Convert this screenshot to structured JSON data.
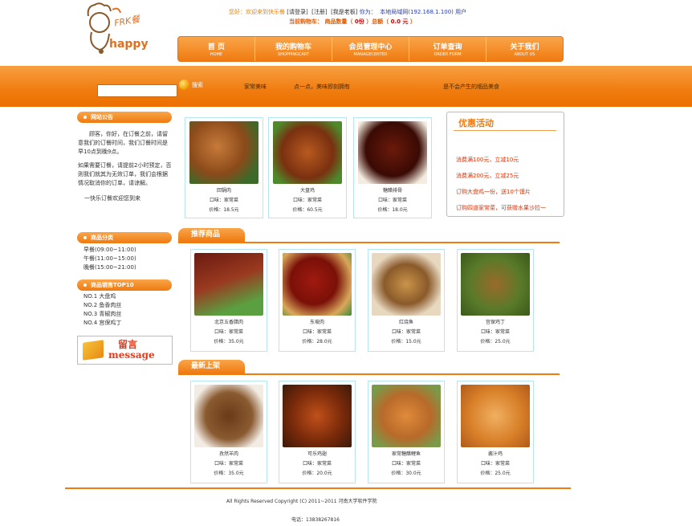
{
  "header": {
    "logo_text": "happy",
    "logo_sign": "FRK餐",
    "top_greeting": "您好：欢迎来到快乐餐",
    "login_link": "[请登录]",
    "register_link": "[注册]",
    "admin_link": "[我是老板]",
    "you_are": "你为：",
    "ip_label": "本地局域网(192.168.1.100) 用户",
    "cart_label": "当前购物车：",
    "cart_count_label": "商品数量（",
    "cart_count": "0份",
    "cart_total_label": "）总额（",
    "cart_total": "0.0 元",
    "cart_end": "）"
  },
  "nav": [
    {
      "cn": "首 页",
      "en": "HOME"
    },
    {
      "cn": "我的购物车",
      "en": "SHOPPINGCART"
    },
    {
      "cn": "会员管理中心",
      "en": "MANAGECENTER"
    },
    {
      "cn": "订单查询",
      "en": "ORDER FORM"
    },
    {
      "cn": "关于我们",
      "en": "ABOUT US"
    }
  ],
  "band": {
    "search_button": "搜索",
    "slogan1": "家常美味",
    "slogan2": "点一点，美味即刻拥有",
    "slogan3": "是不会产生的细品美食"
  },
  "sidebar": {
    "notice_title": "网站公告",
    "notice_p1": "顾客，你好，在订餐之前，请留意我们的订餐时间，我们订餐时间是早10点到晚9点。",
    "notice_p2": "如果需要订餐，请提前2小时预定，否则我们就其为无效订单，我们会根据情况取消你的订单，请谅解。",
    "notice_p3": "一快乐订餐欢迎您到来",
    "category_title": "商品分类",
    "categories": [
      "早餐(09:00~11:00)",
      "午餐(11:00~15:00)",
      "晚餐(15:00~21:00)"
    ],
    "top_title": "商品销售TOP10",
    "top_items": [
      "NO.1 大盘鸡",
      "NO.2 鱼香肉丝",
      "NO.3 青椒肉丝",
      "NO.4 宫保鸡丁"
    ],
    "message_cn": "留言",
    "message_en": "message"
  },
  "featured": [
    {
      "name": "回锅肉",
      "taste": "口味：家常菜",
      "price": "价格：18.5元"
    },
    {
      "name": "大盘鸡",
      "taste": "口味：家常菜",
      "price": "价格：60.5元"
    },
    {
      "name": "糖醋排骨",
      "taste": "口味：家常菜",
      "price": "价格：18.0元"
    }
  ],
  "promo": {
    "title": "优惠活动",
    "items": [
      "消费满100元，立减10元",
      "消费满200元，立减25元",
      "订购大盘鸡一份，送10个馍片",
      "订购四道家常菜，可获赠水果沙拉一"
    ]
  },
  "recommended": {
    "title": "推荐商品",
    "items": [
      {
        "name": "北京五香腊肉",
        "taste": "口味：家常菜",
        "price": "价格：35.0元"
      },
      {
        "name": "东坡肉",
        "taste": "口味：家常菜",
        "price": "价格：28.0元"
      },
      {
        "name": "红烧鱼",
        "taste": "口味：家常菜",
        "price": "价格：15.0元"
      },
      {
        "name": "宫保鸡丁",
        "taste": "口味：家常菜",
        "price": "价格：25.0元"
      }
    ]
  },
  "latest": {
    "title": "最新上架",
    "items": [
      {
        "name": "孜然羊肉",
        "taste": "口味：家常菜",
        "price": "价格：35.0元"
      },
      {
        "name": "可乐鸡翅",
        "taste": "口味：家常菜",
        "price": "价格：20.0元"
      },
      {
        "name": "家常糖醋鲤鱼",
        "taste": "口味：家常菜",
        "price": "价格：30.0元"
      },
      {
        "name": "酱汁鸡",
        "taste": "口味：家常菜",
        "price": "价格：25.0元"
      }
    ]
  },
  "footer": {
    "copyright": "All Rights Reserved Copyright (C) 2011~2011 河南大学软件学院",
    "phone": "电话：13838267816"
  },
  "colors": {
    "accent": "#f07c10",
    "card_border": "#b4e7f3",
    "promo_red": "#e03000"
  },
  "icons": [
    "logo-chef-icon",
    "search-ball-icon",
    "message-book-icon"
  ]
}
